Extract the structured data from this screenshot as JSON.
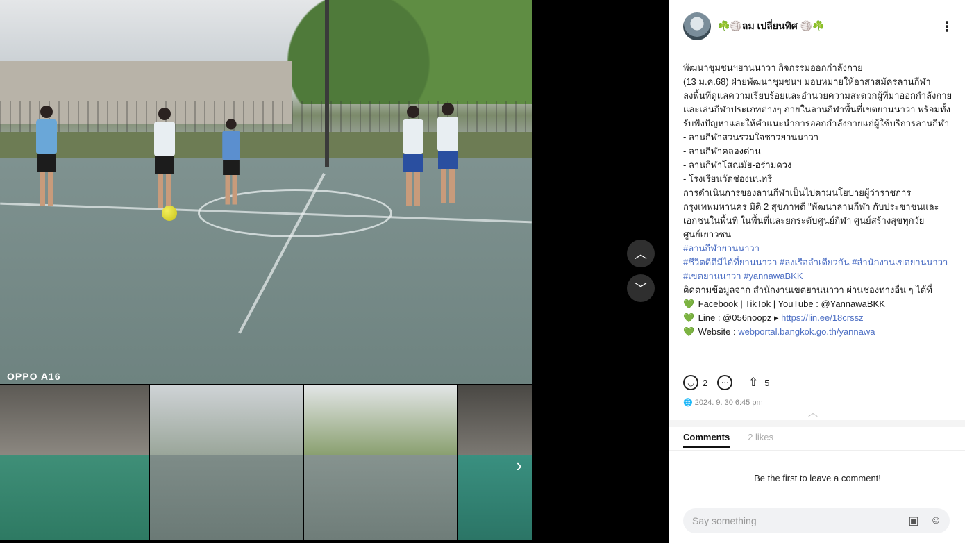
{
  "media": {
    "watermark": "OPPO A16",
    "nav_up_icon": "chevron-up-icon",
    "nav_down_icon": "chevron-down-icon",
    "next_icon": "chevron-right-icon"
  },
  "post": {
    "author": "☘️🏐ลม เปลี่ยนทิศ 🏐☘️",
    "more_icon": "more-vertical-icon",
    "text": "พัฒนาชุมชนฯยานนาวา กิจกรรมออกกำลังกาย\n (13 ม.ค.68)  ฝ่ายพัฒนาชุมชนฯ มอบหมายให้อาสาสมัครลานกีฬา ลงพื้นที่ดูแลความเรียบร้อยและอำนวยความสะดวกผู้ที่มาออกกำลังกายและเล่นกีฬาประเภทต่างๆ ภายในลานกีฬาพื้นที่เขตยานนาวา พร้อมทั้งรับฟังปัญหาและให้คำแนะนำการออกกำลังกายแก่ผู้ใช้บริการลานกีฬา\n- ลานกีฬาสวนรวมใจชาวยานนาวา\n- ลานกีฬาคลองด่าน\n- ลานกีฬาโสณมัย-อร่ามดวง\n- โรงเรียนวัดช่องนนทรี\n   การดำเนินการของลานกีฬาเป็นไปตามนโยบายผู้ว่าราชการกรุงเทพมหานคร  มิติ 2 สุขภาพดี  \"พัฒนาลานกีฬา กับประชาชนและเอกชนในพื้นที่ ในพื้นที่และยกระดับศูนย์กีฬา ศูนย์สร้างสุขทุกวัย ศูนย์เยาวชน",
    "tags_line1": "#ลานกีฬายานนาวา",
    "tags_line2": "#ชีวิตดีดีมีได้ที่ยานนาวา #ลงเรือลำเดียวกัน #สำนักงานเขตยานนาวา #เขตยานนาวา #yannawaBKK",
    "follow_text": "ติดตามข้อมูลจาก สำนักงานเขตยานนาวา ผ่านช่องทางอื่น ๆ ได้ที่",
    "heart": "💚",
    "social_line": "Facebook | TikTok | YouTube : @YannawaBKK",
    "line_label": "Line : @056noopz ▸ ",
    "line_link": "https://lin.ee/18crssz",
    "website_label": "Website : ",
    "website_link": "webportal.bangkok.go.th/yannawa"
  },
  "stats": {
    "reactions_icon": "smile-icon",
    "reactions_count": "2",
    "comment_icon": "comment-icon",
    "share_icon": "share-icon",
    "shares_count": "5",
    "globe_icon": "globe-icon",
    "date": "2024. 9. 30 6:45 pm",
    "collapse_icon": "chevron-up-icon"
  },
  "tabs": {
    "comments": "Comments",
    "likes": "2 likes"
  },
  "comments": {
    "empty": "Be the first to leave a comment!",
    "placeholder": "Say something",
    "image_icon": "image-icon",
    "emoji_icon": "emoji-icon"
  }
}
